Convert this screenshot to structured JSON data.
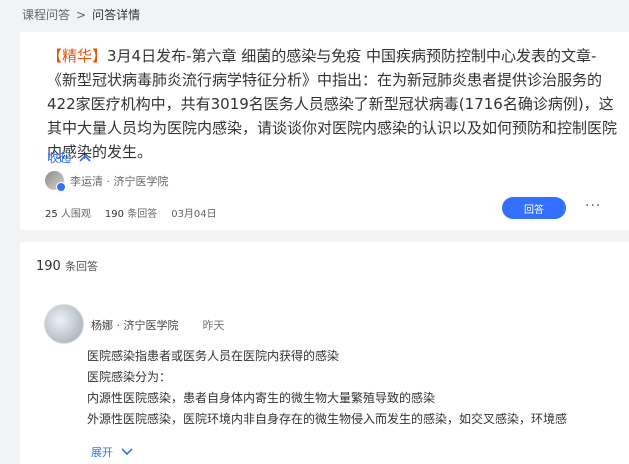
{
  "breadcrumb": {
    "root": "课程问答",
    "current": "问答详情"
  },
  "question": {
    "tag": "【精华】",
    "text": "3月4日发布-第六章 细菌的感染与免疫 中国疾病预防控制中心发表的文章-《新型冠状病毒肺炎流行病学特征分析》中指出：在为新冠肺炎患者提供诊治服务的422家医疗机构中，共有3019名医务人员感染了新型冠状病毒(1716名确诊病例)，这其中大量人员均为医院内感染，请谈谈你对医院内感染的认识以及如何预防和控制医院内感染的发生。",
    "collapse_label": "收起",
    "author": "李运清 · 济宁医学院",
    "views_num": "25",
    "views_label": "人围观",
    "answers_num": "190",
    "answers_label": "条回答",
    "date": "03月04日",
    "answer_button": "回答",
    "more": "···"
  },
  "answers_section": {
    "count": "190",
    "count_label": "条回答",
    "first_answer": {
      "author": "杨娜 · 济宁医学院",
      "time": "昨天",
      "lines": [
        "医院感染指患者或医务人员在医院内获得的感染",
        "医院感染分为：",
        "内源性医院感染，患者自身体内寄生的微生物大量繁殖导致的感染",
        "外源性医院感染，医院环境内非自身存在的微生物侵入而发生的感染，如交叉感染，环境感"
      ],
      "expand_label": "展开"
    }
  },
  "colors": {
    "accent": "#3370ff",
    "tag": "#e8540c"
  }
}
